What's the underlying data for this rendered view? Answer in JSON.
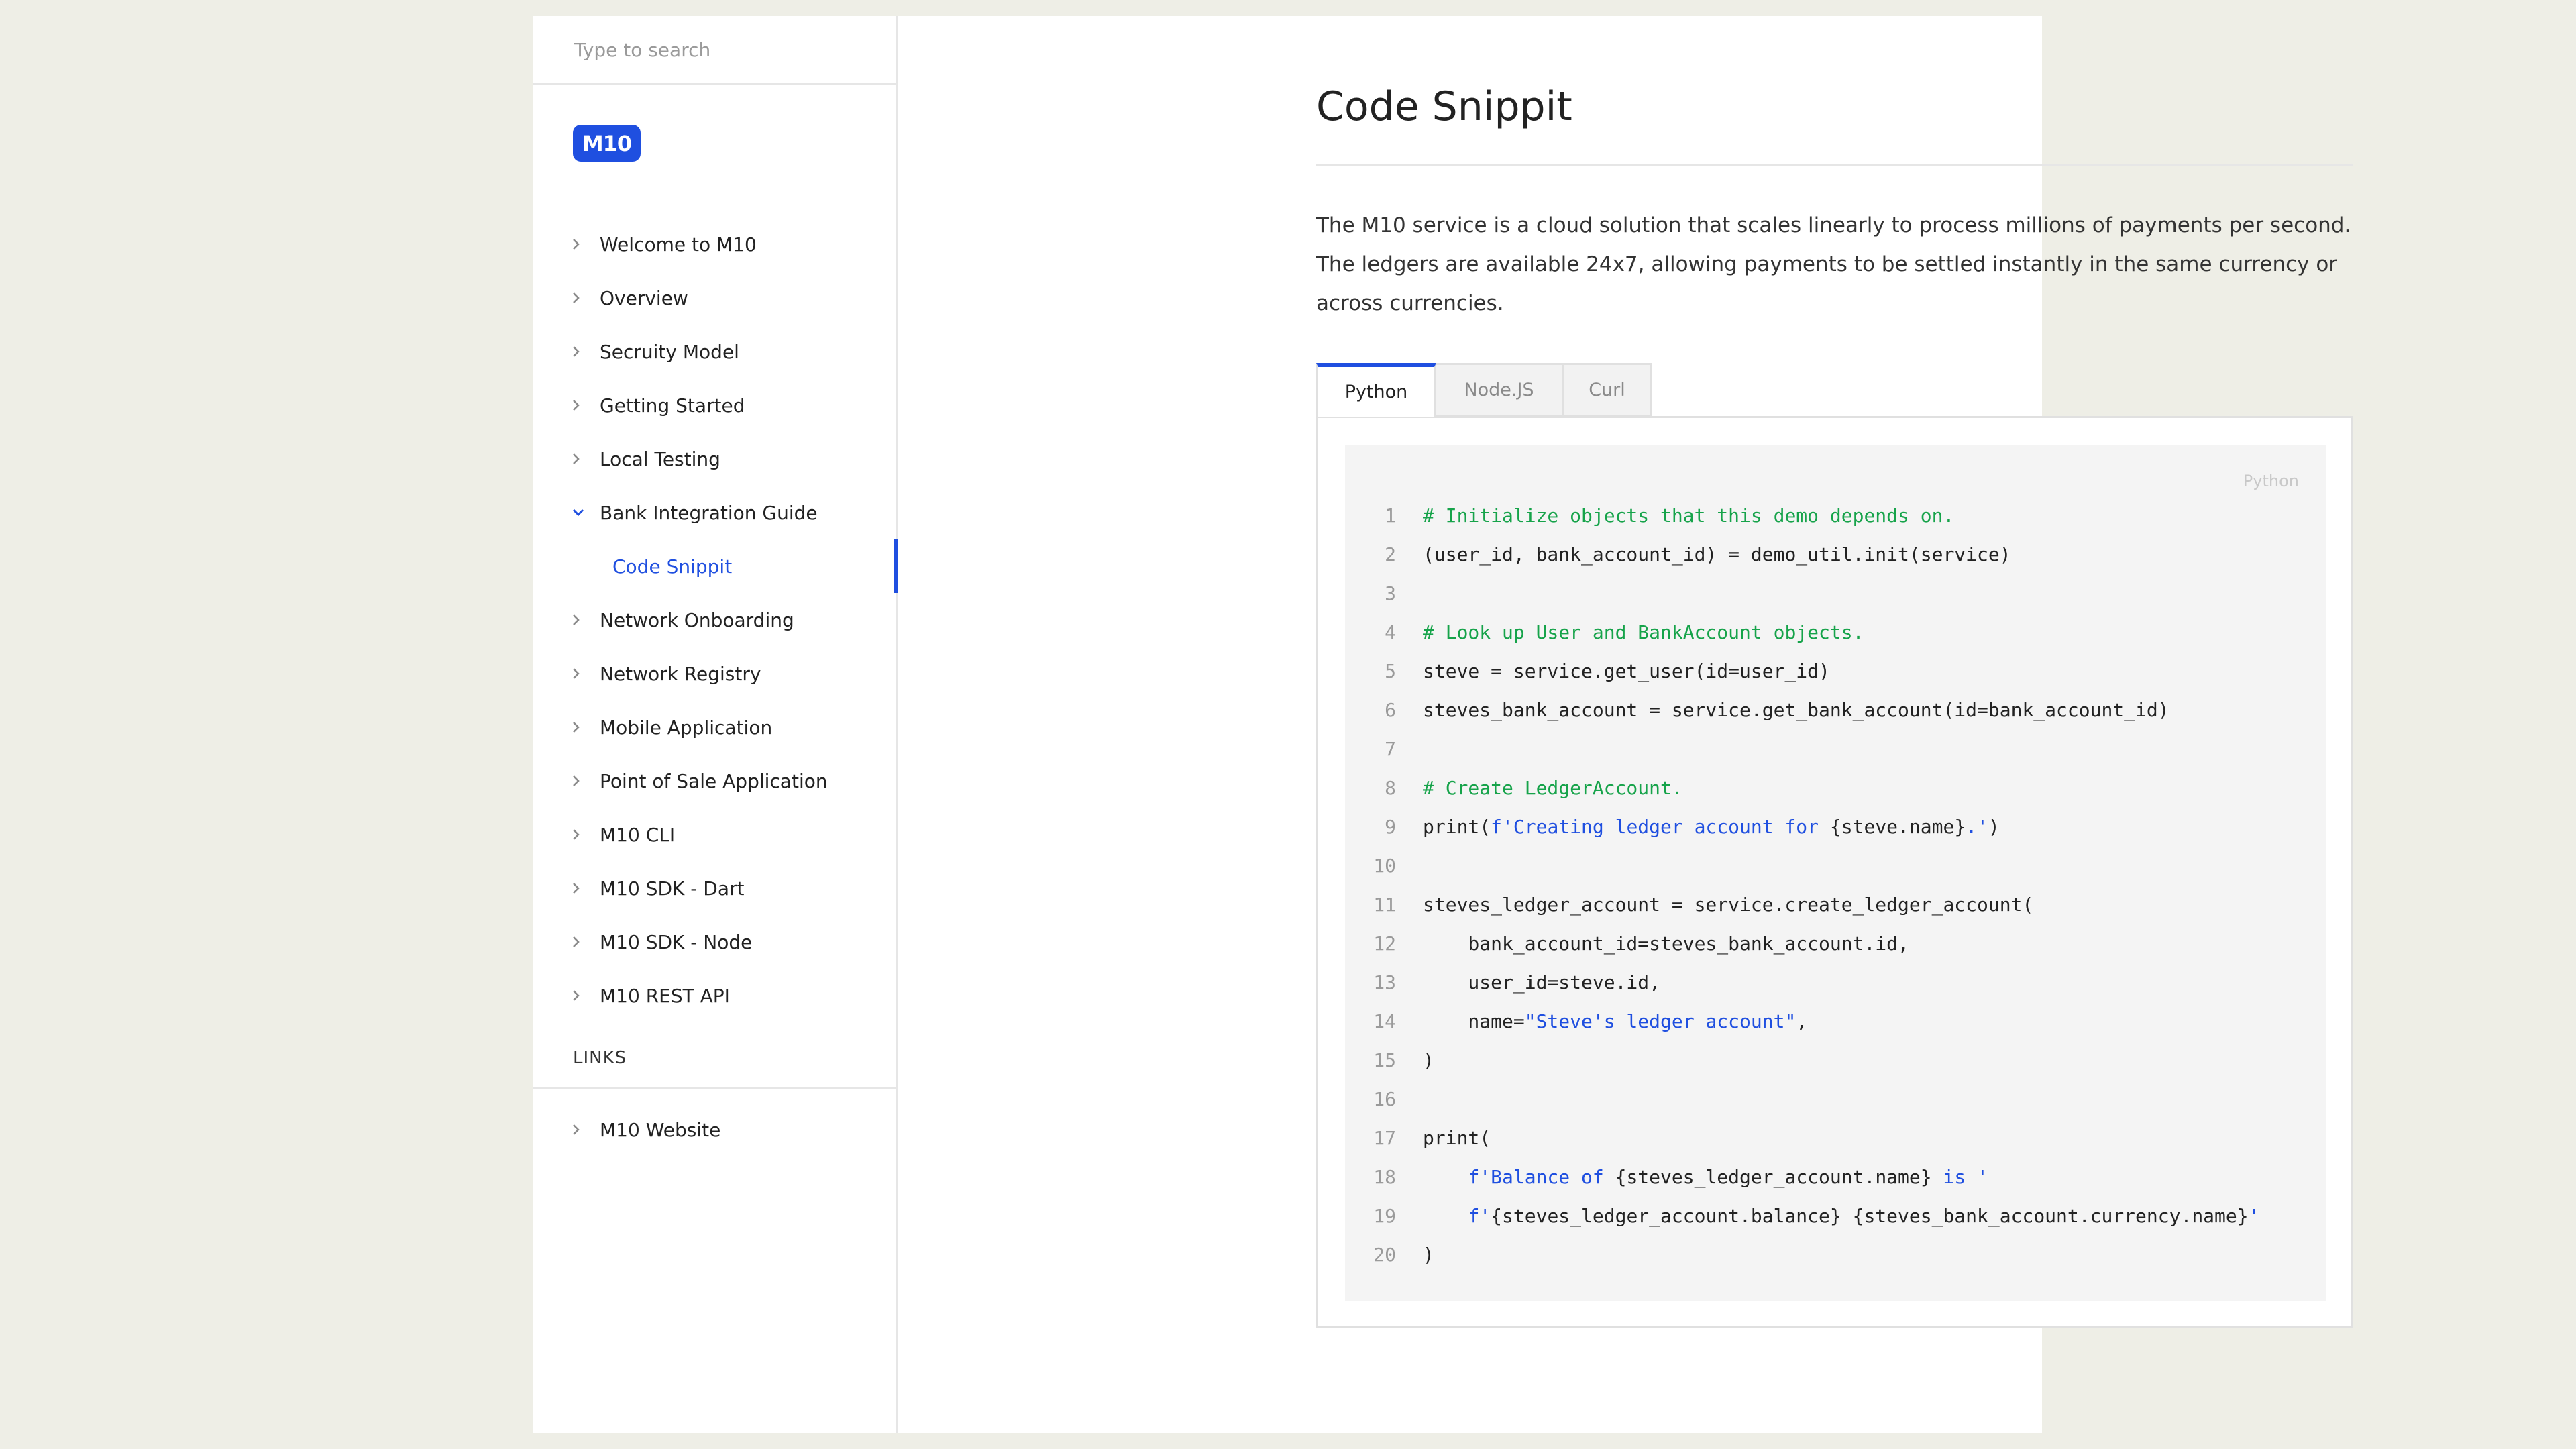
{
  "search": {
    "placeholder": "Type to search"
  },
  "logo": {
    "text": "M10"
  },
  "sidebar": {
    "items": [
      {
        "label": "Welcome to M10",
        "expanded": false
      },
      {
        "label": "Overview",
        "expanded": false
      },
      {
        "label": "Secruity Model",
        "expanded": false
      },
      {
        "label": "Getting Started",
        "expanded": false
      },
      {
        "label": "Local Testing",
        "expanded": false
      },
      {
        "label": "Bank Integration Guide",
        "expanded": true
      },
      {
        "label": "Code Snippit",
        "sub": true,
        "active": true
      },
      {
        "label": "Network Onboarding",
        "expanded": false
      },
      {
        "label": "Network Registry",
        "expanded": false
      },
      {
        "label": "Mobile Application",
        "expanded": false
      },
      {
        "label": "Point of Sale Application",
        "expanded": false
      },
      {
        "label": "M10 CLI",
        "expanded": false
      },
      {
        "label": "M10 SDK - Dart",
        "expanded": false
      },
      {
        "label": "M10 SDK - Node",
        "expanded": false
      },
      {
        "label": "M10 REST API",
        "expanded": false
      }
    ],
    "links_heading": "LINKS",
    "links": [
      {
        "label": "M10 Website"
      }
    ]
  },
  "main": {
    "title": "Code Snippit",
    "description": "The M10 service is a cloud solution that scales linearly to process millions of payments per second. The ledgers are available 24x7, allowing payments to be settled instantly in the same currency or across currencies.",
    "tabs": [
      {
        "label": "Python",
        "active": true
      },
      {
        "label": "Node.JS",
        "active": false
      },
      {
        "label": "Curl",
        "active": false
      }
    ],
    "code": {
      "language_label": "Python",
      "lines": [
        [
          {
            "t": "comment",
            "v": "# Initialize objects that this demo depends on."
          }
        ],
        [
          {
            "t": "plain",
            "v": "(user_id, bank_account_id) = demo_util.init(service)"
          }
        ],
        [],
        [
          {
            "t": "comment",
            "v": "# Look up User and BankAccount objects."
          }
        ],
        [
          {
            "t": "plain",
            "v": "steve = service.get_user(id=user_id)"
          }
        ],
        [
          {
            "t": "plain",
            "v": "steves_bank_account = service.get_bank_account(id=bank_account_id)"
          }
        ],
        [],
        [
          {
            "t": "comment",
            "v": "# Create LedgerAccount."
          }
        ],
        [
          {
            "t": "plain",
            "v": "print("
          },
          {
            "t": "string",
            "v": "f'Creating ledger account "
          },
          {
            "t": "keyword",
            "v": "for"
          },
          {
            "t": "plain",
            "v": " {steve.name}"
          },
          {
            "t": "string",
            "v": ".'"
          },
          {
            "t": "plain",
            "v": ")"
          }
        ],
        [],
        [
          {
            "t": "plain",
            "v": "steves_ledger_account = service.create_ledger_account("
          }
        ],
        [
          {
            "t": "plain",
            "v": "    bank_account_id=steves_bank_account.id,"
          }
        ],
        [
          {
            "t": "plain",
            "v": "    user_id=steve.id,"
          }
        ],
        [
          {
            "t": "plain",
            "v": "    name="
          },
          {
            "t": "string",
            "v": "\"Steve's ledger account\""
          },
          {
            "t": "plain",
            "v": ","
          }
        ],
        [
          {
            "t": "plain",
            "v": ")"
          }
        ],
        [],
        [
          {
            "t": "plain",
            "v": "print("
          }
        ],
        [
          {
            "t": "plain",
            "v": "    "
          },
          {
            "t": "string",
            "v": "f'Balance of "
          },
          {
            "t": "plain",
            "v": "{steves_ledger_account.name}"
          },
          {
            "t": "string",
            "v": " is '"
          }
        ],
        [
          {
            "t": "plain",
            "v": "    "
          },
          {
            "t": "string",
            "v": "f'"
          },
          {
            "t": "plain",
            "v": "{steves_ledger_account.balance} {steves_bank_account.currency.name}"
          },
          {
            "t": "string",
            "v": "'"
          }
        ],
        [
          {
            "t": "plain",
            "v": ")"
          }
        ]
      ]
    }
  },
  "colors": {
    "accent": "#1f4fe0",
    "comment": "#16a34a",
    "background": "#eeeee6"
  }
}
